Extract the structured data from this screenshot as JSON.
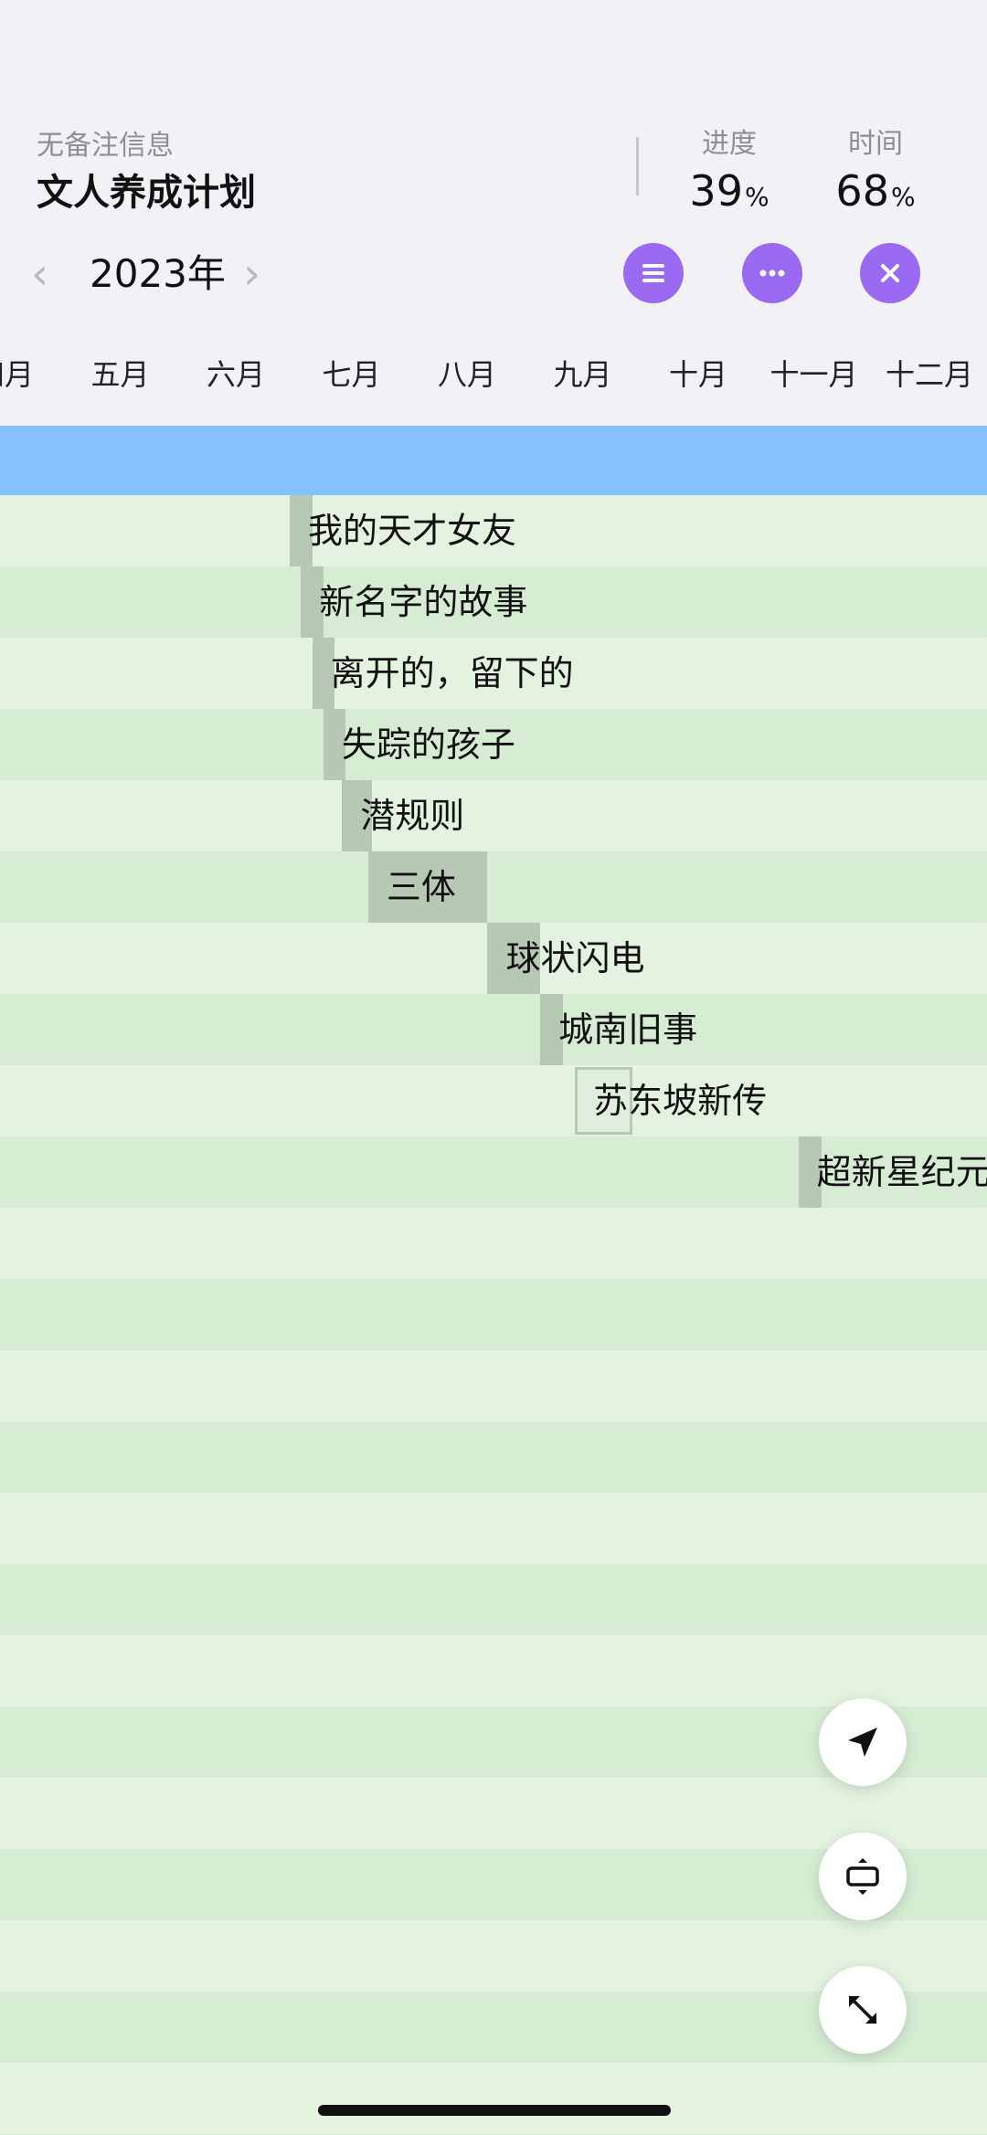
{
  "header": {
    "subtitle": "无备注信息",
    "title": "文人养成计划",
    "progress": {
      "label": "进度",
      "value": "39",
      "unit": "%"
    },
    "time": {
      "label": "时间",
      "value": "68",
      "unit": "%"
    }
  },
  "year_nav": {
    "prev_icon": "chevron-left-icon",
    "year": "2023年",
    "next_icon": "chevron-right-icon"
  },
  "actions": {
    "menu_icon": "list-icon",
    "more_icon": "ellipsis-icon",
    "close_icon": "close-icon",
    "accent_color": "#9b6af2"
  },
  "months": [
    "四月",
    "五月",
    "六月",
    "七月",
    "八月",
    "九月",
    "十月",
    "十一月",
    "十二月"
  ],
  "gantt": {
    "header_color": "#85c1fd",
    "row_colors": [
      "#e3f3e0",
      "#d6ecd3"
    ],
    "bar_color": "#b7c9b4",
    "tasks": [
      {
        "name": "我的天才女友",
        "start": "6月30日",
        "end": "7月6日"
      },
      {
        "name": "新名字的故事",
        "start": "7月3日",
        "end": "7月9日"
      },
      {
        "name": "离开的，留下的",
        "start": "7月6日",
        "end": "7月12日"
      },
      {
        "name": "失踪的孩子",
        "start": "7月9日",
        "end": "7月15日"
      },
      {
        "name": "潜规则",
        "start": "7月14日",
        "end": "7月22日"
      },
      {
        "name": "三体",
        "start": "7月21日",
        "end": "8月22日"
      },
      {
        "name": "球状闪电",
        "start": "8月22日",
        "end": "9月5日"
      },
      {
        "name": "城南旧事",
        "start": "9月5日",
        "end": "9月11日"
      },
      {
        "name": "苏东坡新传",
        "start": "9月14日",
        "end": "9月29日",
        "in_progress": true
      },
      {
        "name": "超新星纪元",
        "start": "11月12日",
        "end": "11月18日"
      }
    ]
  },
  "floating_actions": {
    "locate_icon": "navigation-arrow-icon",
    "fit_icon": "fit-vertical-icon",
    "expand_icon": "expand-arrows-icon"
  }
}
